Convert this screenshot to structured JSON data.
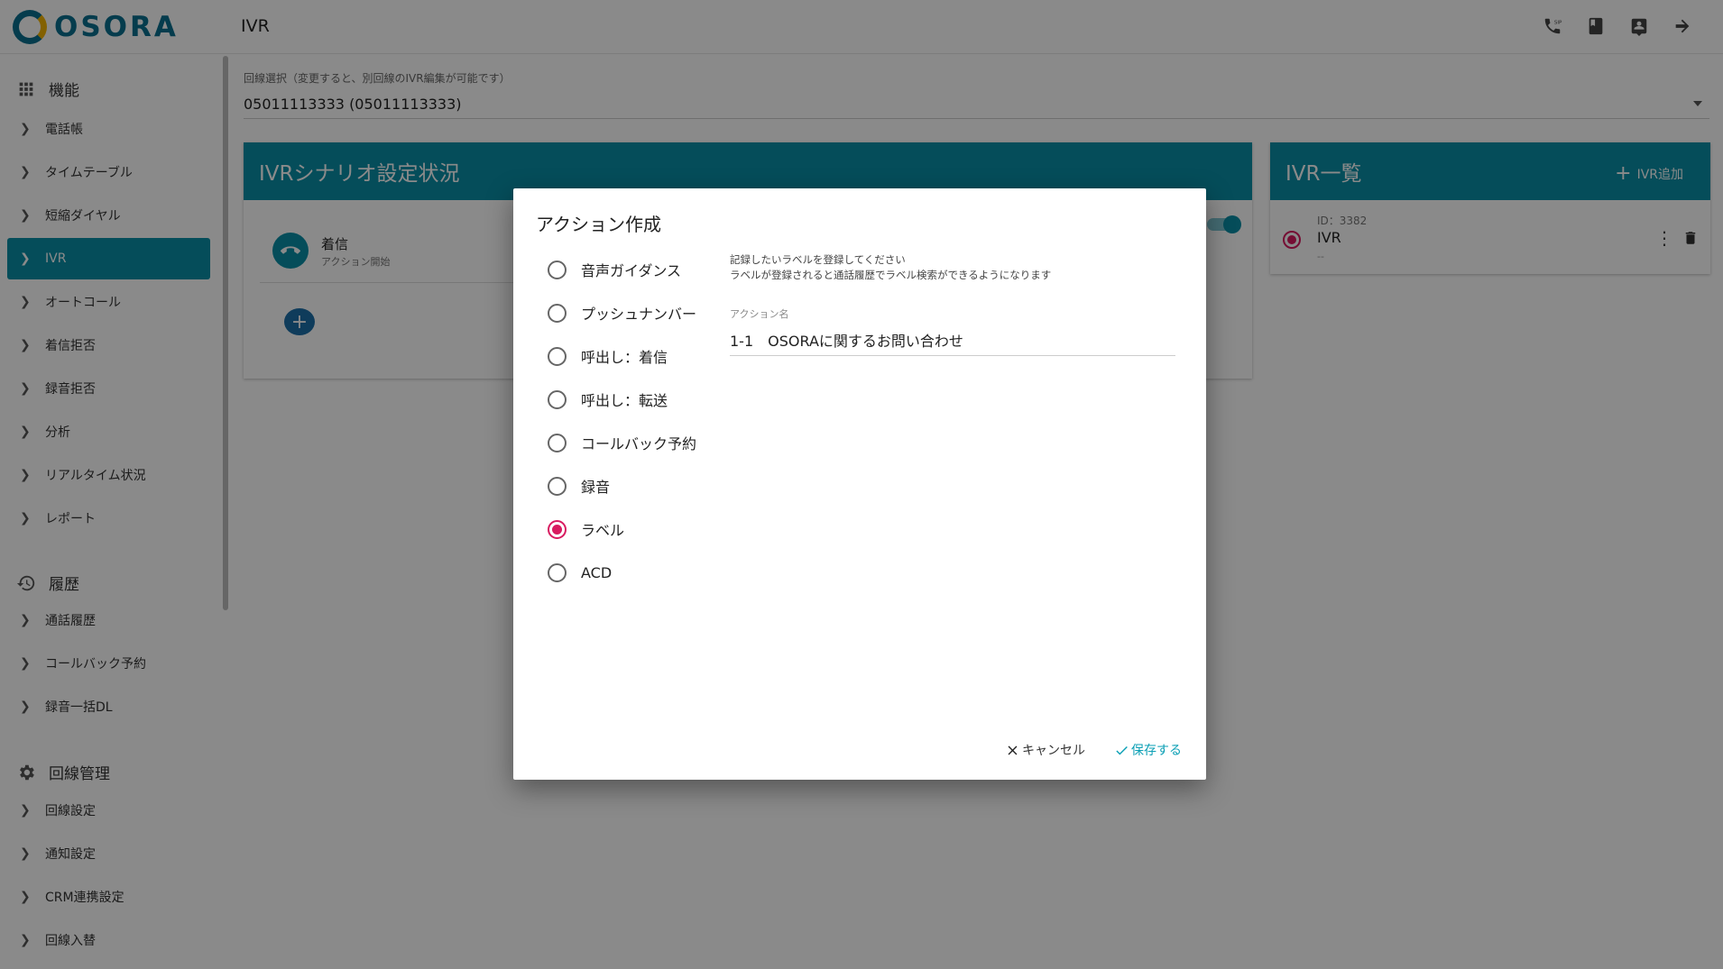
{
  "app": {
    "logo_text": "OSORA",
    "page_title": "IVR"
  },
  "topbar_icons": [
    "sip-phone-icon",
    "book-icon",
    "contact-card-icon",
    "logout-arrow-icon"
  ],
  "sidebar": {
    "sections": [
      {
        "title": "機能",
        "icon": "grid-icon",
        "items": [
          "電話帳",
          "タイムテーブル",
          "短縮ダイヤル",
          "IVR",
          "オートコール",
          "着信拒否",
          "録音拒否",
          "分析",
          "リアルタイム状況",
          "レポート"
        ]
      },
      {
        "title": "履歴",
        "icon": "history-icon",
        "items": [
          "通話履歴",
          "コールバック予約",
          "録音一括DL"
        ]
      },
      {
        "title": "回線管理",
        "icon": "gear-icon",
        "items": [
          "回線設定",
          "通知設定",
          "CRM連携設定",
          "回線入替"
        ]
      }
    ],
    "active_item": "IVR"
  },
  "main": {
    "line_select_label": "回線選択（変更すると、別回線のIVR編集が可能です）",
    "line_select_value": "05011113333 (05011113333)",
    "scenario_panel": {
      "title": "IVRシナリオ設定状況",
      "incoming_title": "着信",
      "incoming_sub": "アクション開始",
      "add_label": "+"
    },
    "ivr_list_panel": {
      "title": "IVR一覧",
      "add_label": "IVR追加",
      "items": [
        {
          "id_text": "ID：3382",
          "name": "IVR",
          "sub": "--"
        }
      ]
    }
  },
  "dialog": {
    "title": "アクション作成",
    "options": [
      "音声ガイダンス",
      "プッシュナンバー",
      "呼出し：着信",
      "呼出し：転送",
      "コールバック予約",
      "録音",
      "ラベル",
      "ACD"
    ],
    "selected_option": "ラベル",
    "help_line1": "記録したいラベルを登録してください",
    "help_line2": "ラベルが登録されると通話履歴でラベル検索ができるようになります",
    "field_label": "アクション名",
    "field_value": "1-1　OSORAに関するお問い合わせ",
    "cancel_label": "キャンセル",
    "save_label": "保存する"
  },
  "colors": {
    "accent": "#0a8fa6",
    "selected_radio": "#d81b60",
    "save_text": "#0a9fb5"
  }
}
